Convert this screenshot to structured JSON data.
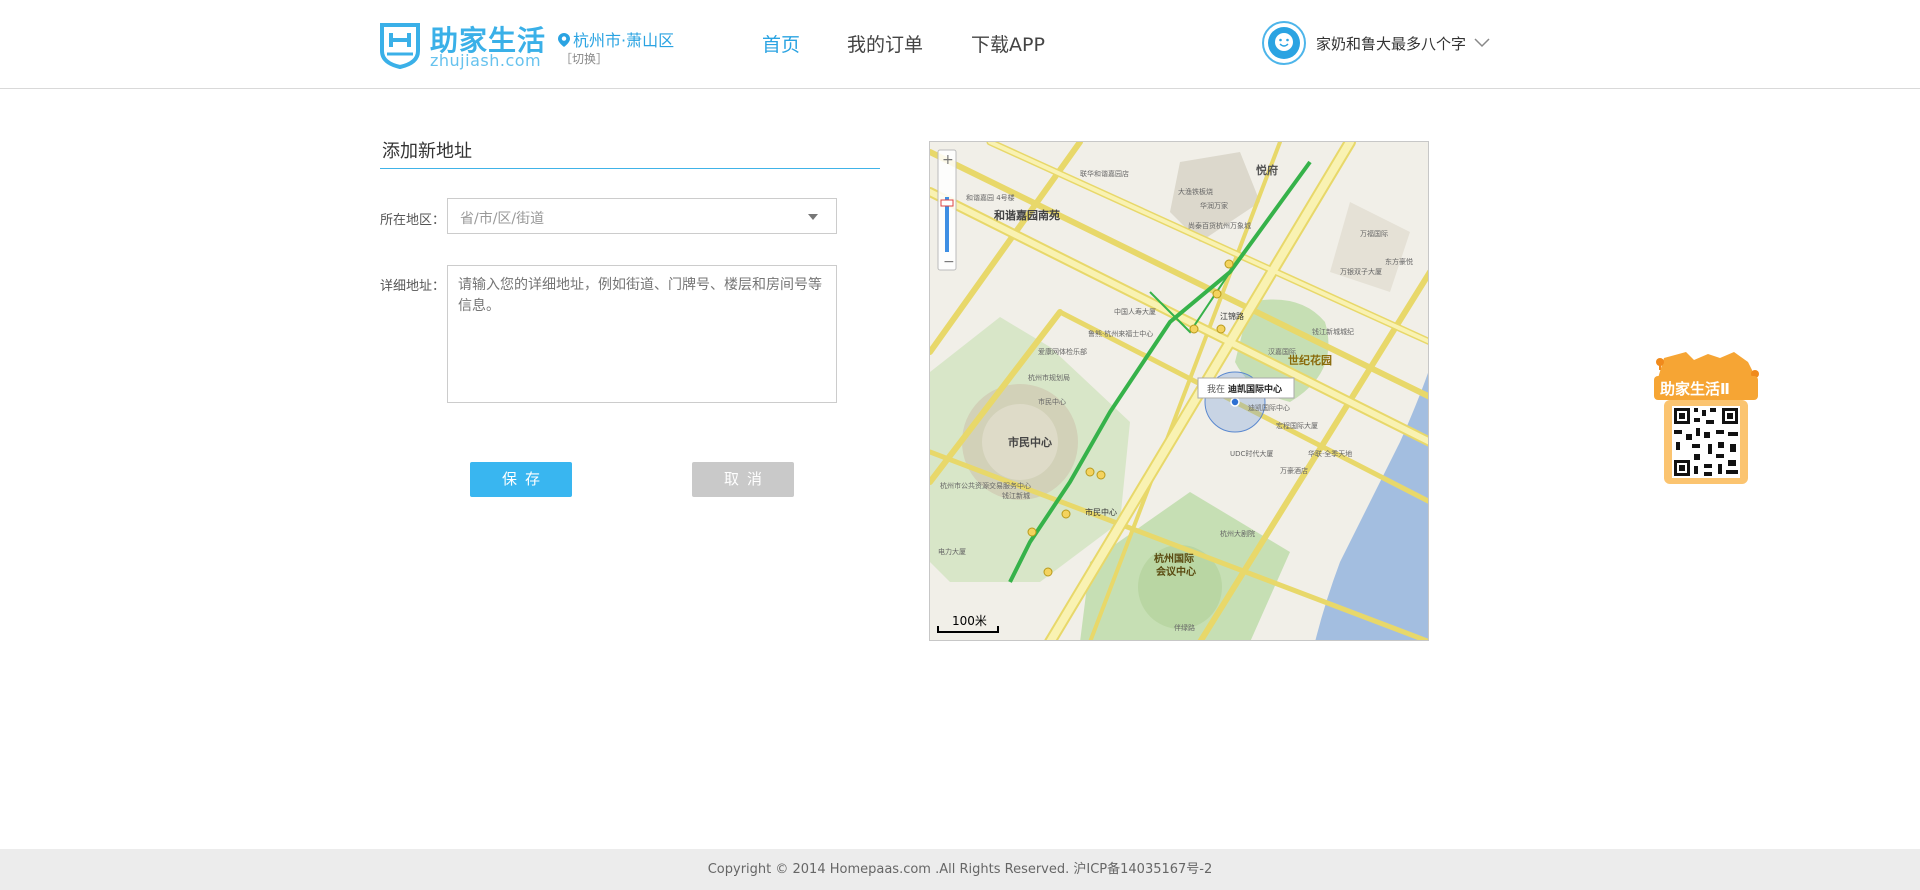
{
  "header": {
    "logo_name": "助家生活",
    "logo_sub": "zhujiash.com",
    "city": "杭州市·萧山区",
    "switch": "［切换］",
    "nav": [
      {
        "label": "首页",
        "active": true
      },
      {
        "label": "我的订单",
        "active": false
      },
      {
        "label": "下载APP",
        "active": false
      }
    ],
    "user_name": "家奶和鲁大最多八个字"
  },
  "form": {
    "title": "添加新地址",
    "region_label": "所在地区：",
    "region_placeholder": "省/市/区/街道",
    "detail_label": "详细地址：",
    "detail_placeholder": "请输入您的详细地址，例如街道、门牌号、楼层和房间号等信息。",
    "save": "保存",
    "cancel": "取消"
  },
  "map": {
    "labels": {
      "yuefu": "悦府",
      "heyu": "和谐嘉园南苑",
      "century": "世纪花园",
      "civic": "市民中心",
      "expo": "杭州国际\n会议中心",
      "jianglu": "江锦路",
      "shimin": "市民中心",
      "here_prefix": "我在",
      "here_place": "迪凯国际中心",
      "scale": "100米",
      "pois": [
        "联华和谐嘉园店",
        "和谐嘉园 4号楼",
        "大渔铁板烧",
        "华润万家",
        "尚泰百货杭州万象城",
        "万福国际",
        "东方豪悦",
        "万银双子大厦",
        "中国人寿大厦",
        "鲁熊·杭州来福士中心",
        "爱康网体检乐部",
        "杭州市规划局",
        "市民中心",
        "汉嘉国际",
        "钱江新城城纪",
        "迪凯国际中心",
        "宏程国际大厦",
        "UDC时代大厦",
        "华联·全季天地",
        "万豪酒店",
        "杭州市公共资源交易服务中心",
        "钱江新城",
        "杭州大剧院",
        "电力大厦",
        "伴绿路"
      ]
    }
  },
  "side_ad": {
    "title": "助家生活Ⅱ"
  },
  "footer": {
    "text": "Copyright © 2014 Homepaas.com .All Rights Reserved. 沪ICP备14035167号-2"
  },
  "colors": {
    "accent": "#2aa3e2",
    "save": "#39b6f0",
    "cancel": "#c9c9c9",
    "water": "#a3bee0",
    "park": "#c6dfb4",
    "road": "#f9e984"
  }
}
